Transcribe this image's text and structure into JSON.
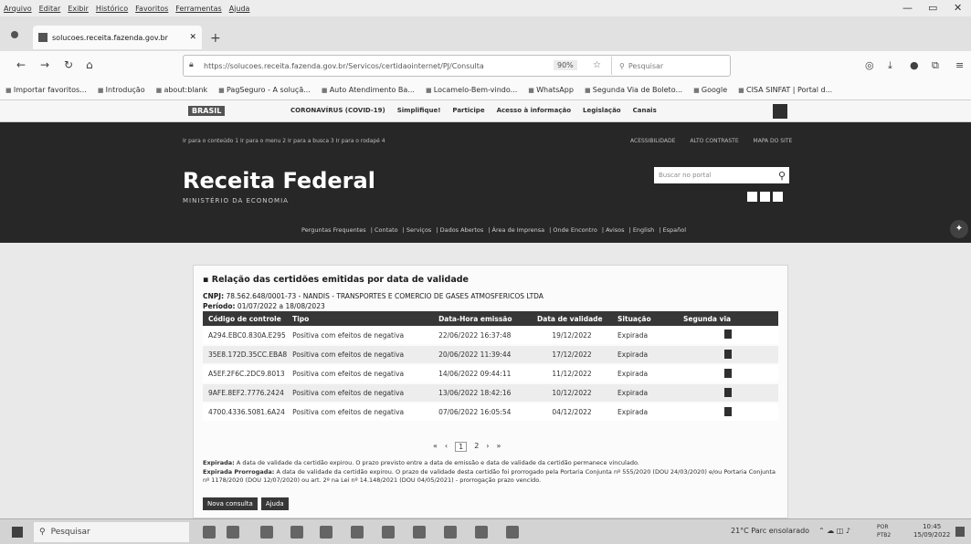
{
  "menubar": {
    "items": [
      "Arquivo",
      "Editar",
      "Exibir",
      "Histórico",
      "Favoritos",
      "Ferramentas",
      "Ajuda"
    ]
  },
  "tab": {
    "title": "solucoes.receita.fazenda.gov.br"
  },
  "address": {
    "url": "https://solucoes.receita.fazenda.gov.br/Servicos/certidaointernet/PJ/Consulta",
    "zoom": "90%",
    "search_placeholder": "Pesquisar"
  },
  "bookmarks": [
    "Importar favoritos...",
    "Introdução",
    "about:blank",
    "PagSeguro - A soluçã...",
    "Auto Atendimento Ba...",
    "Locamelo-Bem-vindo...",
    "WhatsApp",
    "Segunda Via de Boleto...",
    "Google",
    "CISA SINFAT | Portal d..."
  ],
  "govbar": {
    "brasil": "BRASIL",
    "links": [
      "CORONAVÍRUS (COVID-19)",
      "Simplifique!",
      "Participe",
      "Acesso à informação",
      "Legislação",
      "Canais"
    ]
  },
  "header": {
    "accessibility": "Ir para o conteúdo 1  Ir para o menu 2  Ir para a busca 3  Ir para o rodapé 4",
    "top_links": [
      "ACESSIBILIDADE",
      "ALTO CONTRASTE",
      "MAPA DO SITE"
    ],
    "logo": "Receita Federal",
    "subtitle": "MINISTÉRIO DA ECONOMIA",
    "search_placeholder": "Buscar no portal",
    "nav": [
      "Perguntas Frequentes",
      "Contato",
      "Serviços",
      "Dados Abertos",
      "Área de Imprensa",
      "Onde Encontro",
      "Avisos",
      "English",
      "Español"
    ]
  },
  "report": {
    "title": "Relação das certidões emitidas por data de validade",
    "cnpj_label": "CNPJ:",
    "cnpj_value": "78.562.648/0001-73 - NANDIS - TRANSPORTES E COMERCIO DE GASES ATMOSFERICOS LTDA",
    "periodo_label": "Período:",
    "periodo_value": "01/07/2022 a 18/08/2023",
    "columns": [
      "Código de controle",
      "Tipo",
      "Data-Hora emissão",
      "Data de validade",
      "Situação",
      "Segunda via"
    ],
    "rows": [
      [
        "A294.EBC0.830A.E295",
        "Positiva com efeitos de negativa",
        "22/06/2022 16:37:48",
        "19/12/2022",
        "Expirada"
      ],
      [
        "35E8.172D.35CC.EBA8",
        "Positiva com efeitos de negativa",
        "20/06/2022 11:39:44",
        "17/12/2022",
        "Expirada"
      ],
      [
        "A5EF.2F6C.2DC9.8013",
        "Positiva com efeitos de negativa",
        "14/06/2022 09:44:11",
        "11/12/2022",
        "Expirada"
      ],
      [
        "9AFE.8EF2.7776.2424",
        "Positiva com efeitos de negativa",
        "13/06/2022 18:42:16",
        "10/12/2022",
        "Expirada"
      ],
      [
        "4700.4336.5081.6A24",
        "Positiva com efeitos de negativa",
        "07/06/2022 16:05:54",
        "04/12/2022",
        "Expirada"
      ]
    ],
    "pager": {
      "first": "«",
      "prev": "‹",
      "pages": [
        "1",
        "2"
      ],
      "next": "›",
      "last": "»"
    },
    "legend_expirada_label": "Expirada:",
    "legend_expirada": "A data de validade da certidão expirou. O prazo previsto entre a data de emissão e data de validade da certidão permanece vinculado.",
    "legend_prorrogada_label": "Expirada Prorrogada:",
    "legend_prorrogada": "A data de validade da certidão expirou. O prazo de validade desta certidão foi prorrogado pela Portaria Conjunta nº 555/2020 (DOU 24/03/2020) e/ou Portaria Conjunta nº 1178/2020 (DOU 12/07/2020) ou art. 2º na Lei nº 14.148/2021 (DOU 04/05/2021) - prorrogação prazo vencido.",
    "buttons": [
      "Nova consulta",
      "Ajuda"
    ]
  },
  "taskbar": {
    "search_placeholder": "Pesquisar",
    "weather": "21°C  Parc ensolarado",
    "lang": [
      "POR",
      "PTB2"
    ],
    "time": "10:45",
    "date": "15/09/2022"
  }
}
